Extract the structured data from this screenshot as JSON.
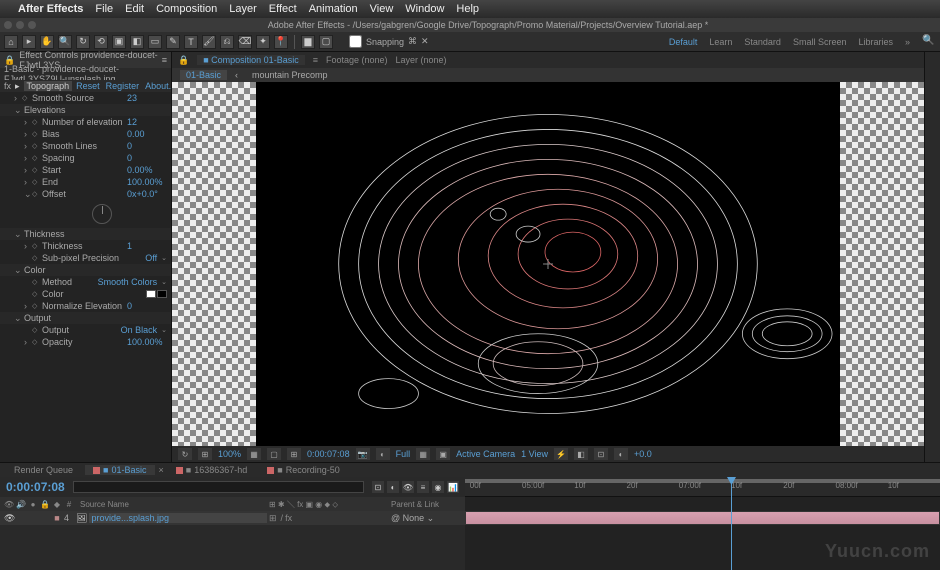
{
  "menubar": {
    "items": [
      "After Effects",
      "File",
      "Edit",
      "Composition",
      "Layer",
      "Effect",
      "Animation",
      "View",
      "Window",
      "Help"
    ]
  },
  "titlebar": {
    "title": "Adobe After Effects - /Users/gabgren/Google Drive/Topograph/Promo Material/Projects/Overview Tutorial.aep *"
  },
  "toolbar": {
    "snapping": "Snapping",
    "workspaces": [
      "Default",
      "Learn",
      "Standard",
      "Small Screen",
      "Libraries"
    ]
  },
  "effect_panel": {
    "tab": "Effect Controls providence-doucet-FJwtL3YS",
    "layer": "1-Basic · providence-doucet-FJwtL3YSZ9U-unsplash.jpg",
    "effect_name": "Topograph",
    "links": [
      "Reset",
      "Register",
      "About..."
    ],
    "props": {
      "smooth_source": {
        "label": "Smooth Source",
        "value": "23"
      },
      "elevations_group": "Elevations",
      "num_elevation": {
        "label": "Number of elevation",
        "value": "12"
      },
      "bias": {
        "label": "Bias",
        "value": "0.00"
      },
      "smooth_lines": {
        "label": "Smooth Lines",
        "value": "0"
      },
      "spacing": {
        "label": "Spacing",
        "value": "0"
      },
      "start": {
        "label": "Start",
        "value": "0.00%"
      },
      "end": {
        "label": "End",
        "value": "100.00%"
      },
      "offset": {
        "label": "Offset",
        "value": "0x+0.0°"
      },
      "thickness_group": "Thickness",
      "thickness": {
        "label": "Thickness",
        "value": "1"
      },
      "subpixel": {
        "label": "Sub-pixel Precision",
        "value": "Off"
      },
      "color_group": "Color",
      "method": {
        "label": "Method",
        "value": "Smooth Colors"
      },
      "color": {
        "label": "Color"
      },
      "normalize": {
        "label": "Normalize Elevation",
        "value": "0"
      },
      "output_group": "Output",
      "output": {
        "label": "Output",
        "value": "On Black"
      },
      "opacity": {
        "label": "Opacity",
        "value": "100.00%"
      }
    }
  },
  "viewer": {
    "tabs": {
      "composition": "Composition 01-Basic",
      "footage": "Footage (none)",
      "layer": "Layer (none)"
    },
    "breadcrumb": [
      "01-Basic",
      "mountain Precomp"
    ],
    "footer": {
      "zoom": "100%",
      "time": "0:00:07:08",
      "res": "Full",
      "camera": "Active Camera",
      "views": "1 View",
      "exposure": "+0.0"
    }
  },
  "timeline": {
    "tabs": {
      "render": "Render Queue",
      "comp": "01-Basic",
      "asset1": "16386367-hd",
      "asset2": "Recording-50"
    },
    "time": "0:00:07:08",
    "cols": {
      "num": "#",
      "source": "Source Name",
      "parent": "Parent & Link"
    },
    "layer": {
      "num": "4",
      "name": "provide...splash.jpg",
      "parent": "None"
    },
    "ruler": [
      "00f",
      "05:00f",
      "10f",
      "20f",
      "07:00f",
      "10f",
      "20f",
      "08:00f",
      "10f"
    ]
  },
  "watermark": "Yuucn.com"
}
